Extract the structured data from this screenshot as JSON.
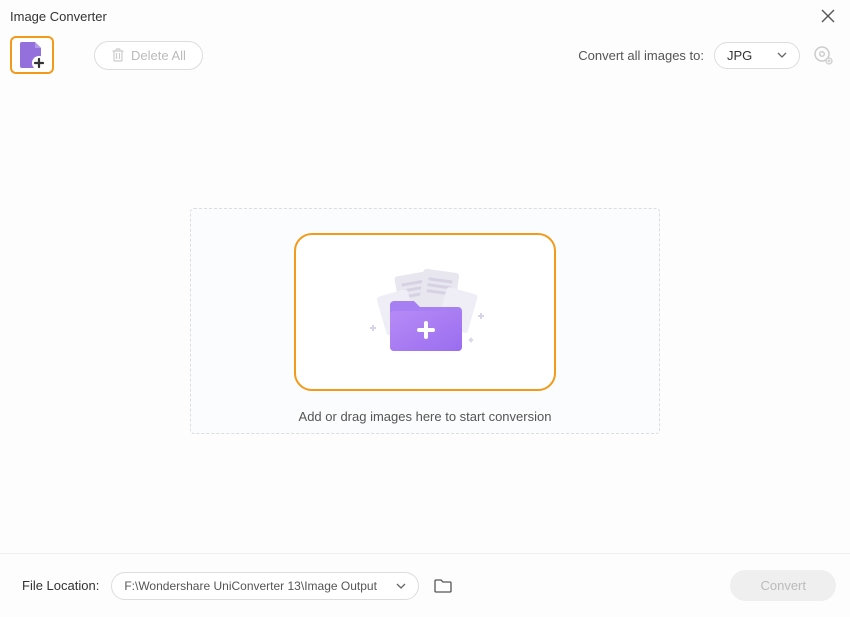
{
  "window": {
    "title": "Image Converter"
  },
  "toolbar": {
    "delete_all_label": "Delete All",
    "convert_all_label": "Convert all images to:",
    "format_selected": "JPG"
  },
  "dropzone": {
    "text": "Add or drag images here to start conversion"
  },
  "footer": {
    "file_location_label": "File Location:",
    "path": "F:\\Wondershare UniConverter 13\\Image Output",
    "convert_label": "Convert"
  }
}
